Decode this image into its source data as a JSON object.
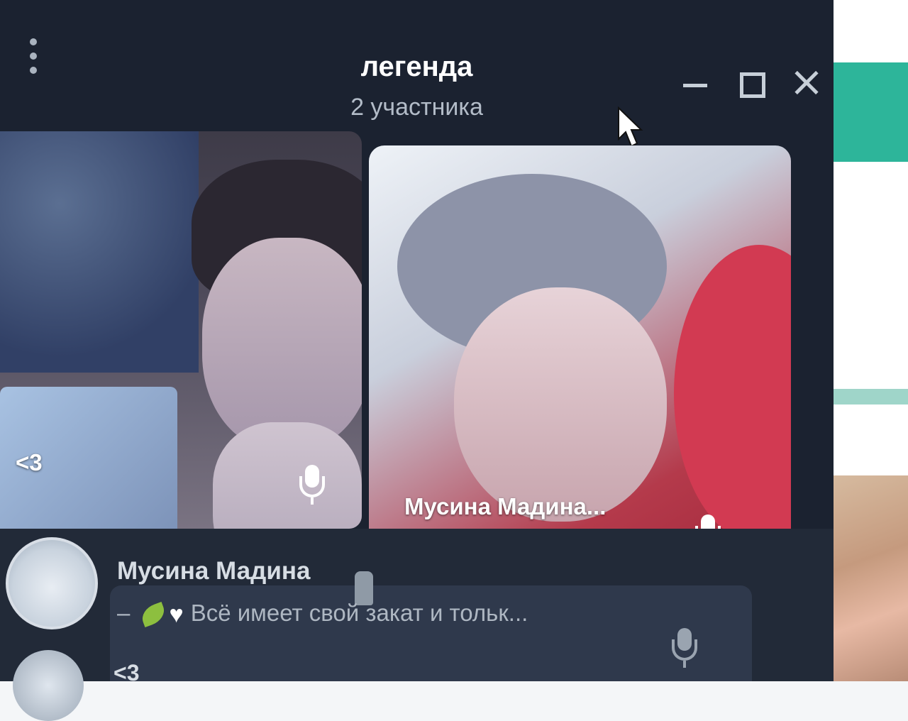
{
  "window": {
    "title": "легенда",
    "subtitle": "2 участника"
  },
  "tiles": [
    {
      "name": "<3"
    },
    {
      "name": "Мусина Мадина..."
    }
  ],
  "participants": [
    {
      "name": "Мусина Мадина",
      "status_prefix": "–",
      "status_text": "Всё имеет свой закат и тольк...",
      "icons": [
        "moai-icon",
        "leaf-icon",
        "heart-icon",
        "mic-icon"
      ]
    },
    {
      "name": "<3"
    }
  ],
  "colors": {
    "window_bg": "#1b2230",
    "speaking_tile": "#b43a4b",
    "list_bg": "#222a38"
  }
}
